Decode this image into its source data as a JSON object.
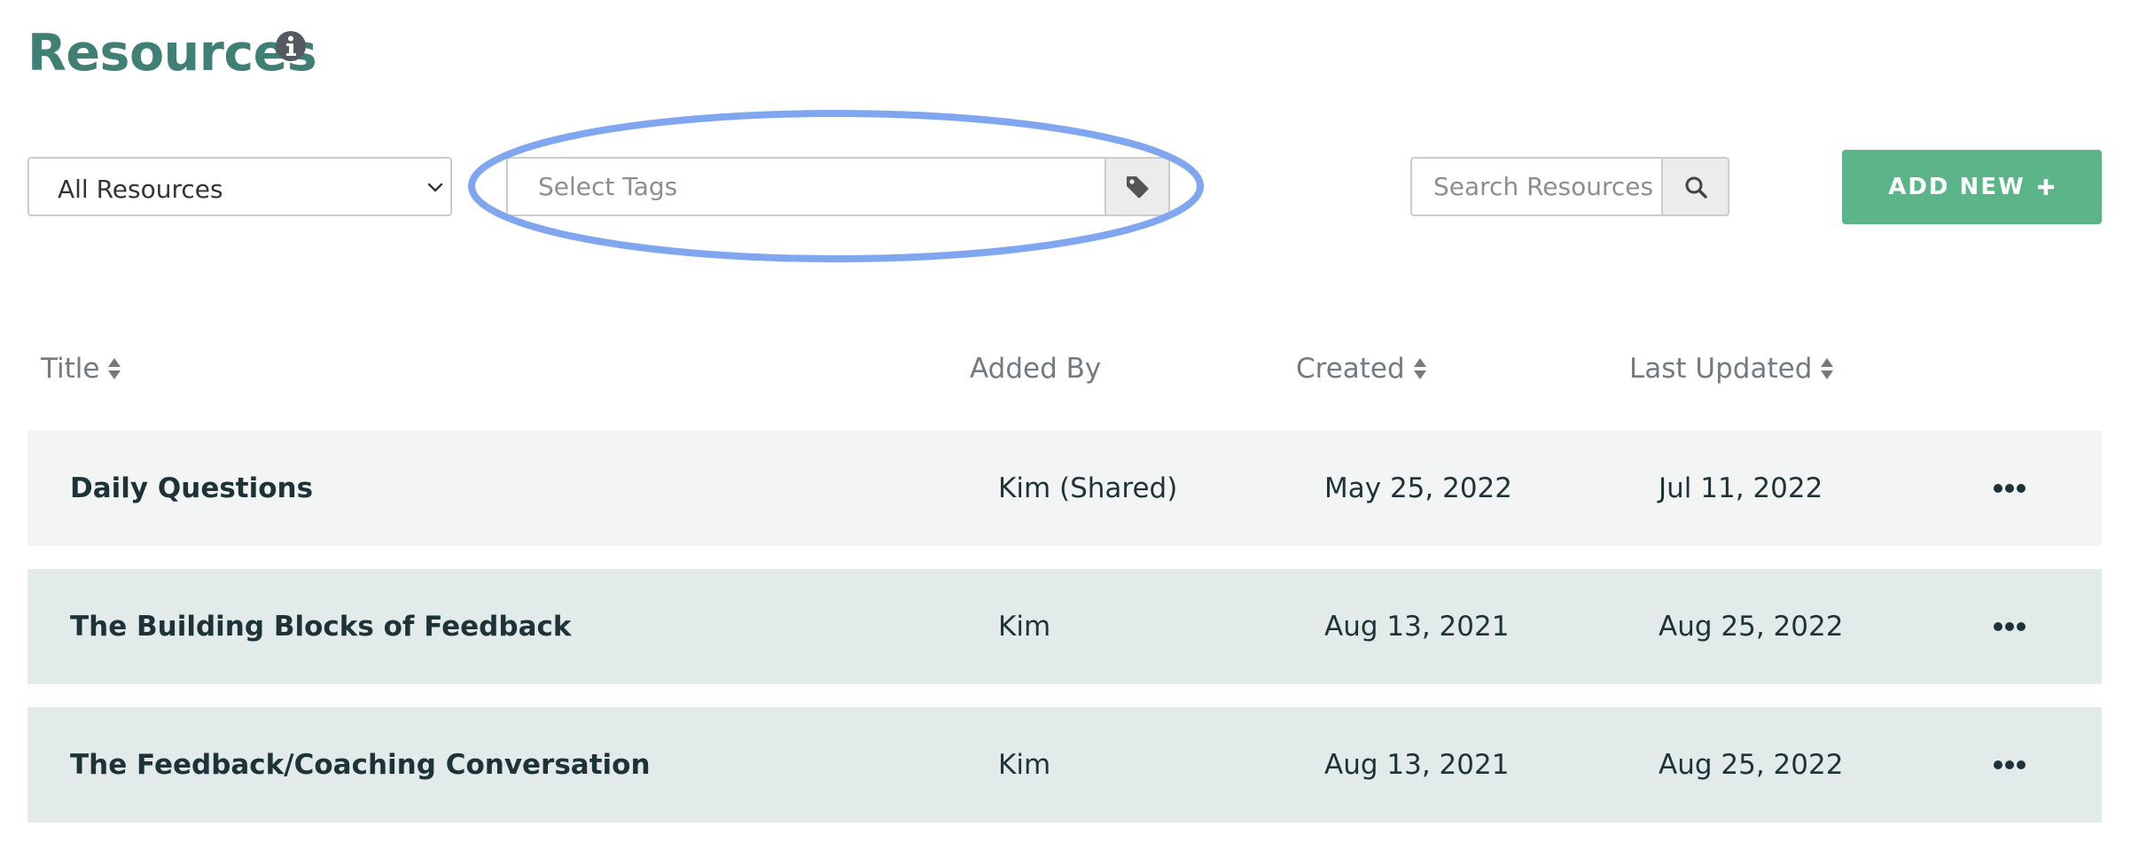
{
  "page": {
    "title": "Resources"
  },
  "filters": {
    "resource_type": {
      "selected": "All Resources"
    },
    "tags": {
      "placeholder": "Select Tags"
    },
    "search": {
      "placeholder": "Search Resources"
    },
    "add_new_label": "ADD NEW"
  },
  "table": {
    "columns": [
      {
        "label": "Title",
        "sortable": true
      },
      {
        "label": "Added By",
        "sortable": false
      },
      {
        "label": "Created",
        "sortable": true
      },
      {
        "label": "Last Updated",
        "sortable": true
      }
    ],
    "rows": [
      {
        "title": "Daily Questions",
        "added_by": "Kim (Shared)",
        "created": "May 25, 2022",
        "last_updated": "Jul 11, 2022"
      },
      {
        "title": "The Building Blocks of Feedback",
        "added_by": "Kim",
        "created": "Aug 13, 2021",
        "last_updated": "Aug 25, 2022"
      },
      {
        "title": "The Feedback/Coaching Conversation",
        "added_by": "Kim",
        "created": "Aug 13, 2021",
        "last_updated": "Aug 25, 2022"
      }
    ]
  },
  "icons": {
    "info": "info-icon",
    "chevron": "chevron-down-icon",
    "tag": "tag-icon",
    "search": "search-icon",
    "plus": "plus-icon",
    "sort": "sort-icon",
    "more": "more-options-icon"
  },
  "colors": {
    "title": "#3f7f74",
    "accent_button": "#5cb489",
    "highlight_ellipse": "#7fa6ee",
    "row_odd": "#f3f5f5",
    "row_even": "#e2eaea",
    "header_text": "#737b82",
    "cell_text": "#1e3338"
  }
}
